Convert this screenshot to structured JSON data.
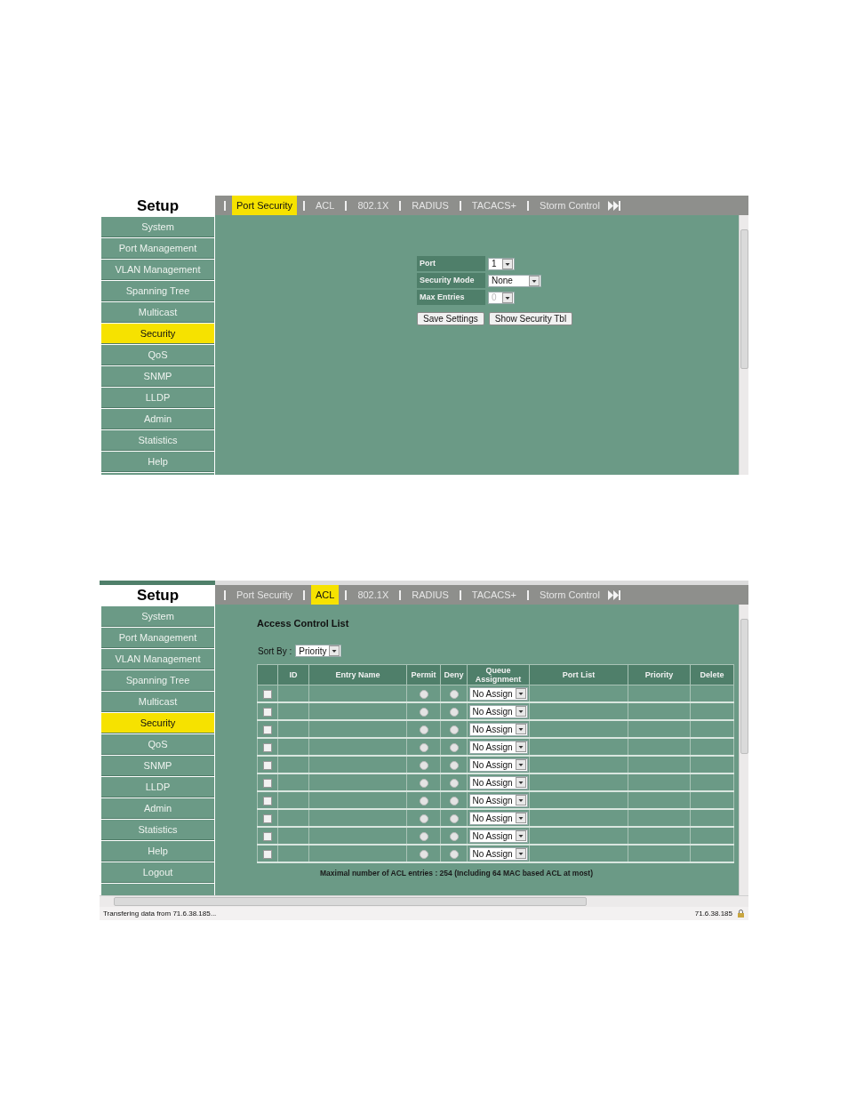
{
  "screens": [
    {
      "sidebar": {
        "title": "Setup",
        "items": [
          {
            "label": "System",
            "selected": false
          },
          {
            "label": "Port Management",
            "selected": false
          },
          {
            "label": "VLAN Management",
            "selected": false
          },
          {
            "label": "Spanning Tree",
            "selected": false
          },
          {
            "label": "Multicast",
            "selected": false
          },
          {
            "label": "Security",
            "selected": true
          },
          {
            "label": "QoS",
            "selected": false
          },
          {
            "label": "SNMP",
            "selected": false
          },
          {
            "label": "LLDP",
            "selected": false
          },
          {
            "label": "Admin",
            "selected": false
          },
          {
            "label": "Statistics",
            "selected": false
          },
          {
            "label": "Help",
            "selected": false
          }
        ]
      },
      "tabs": [
        {
          "label": "Port Security",
          "selected": true
        },
        {
          "label": "ACL",
          "selected": false
        },
        {
          "label": "802.1X",
          "selected": false
        },
        {
          "label": "RADIUS",
          "selected": false
        },
        {
          "label": "TACACS+",
          "selected": false
        },
        {
          "label": "Storm Control",
          "selected": false
        }
      ],
      "content": {
        "kind": "form",
        "fields": [
          {
            "label": "Port",
            "value": "1",
            "disabled": false
          },
          {
            "label": "Security Mode",
            "value": "None",
            "disabled": false
          },
          {
            "label": "Max Entries",
            "value": "0",
            "disabled": true
          }
        ],
        "buttons": [
          "Save Settings",
          "Show Security Tbl"
        ]
      }
    },
    {
      "sidebar": {
        "title": "Setup",
        "items": [
          {
            "label": "System",
            "selected": false
          },
          {
            "label": "Port Management",
            "selected": false
          },
          {
            "label": "VLAN Management",
            "selected": false
          },
          {
            "label": "Spanning Tree",
            "selected": false
          },
          {
            "label": "Multicast",
            "selected": false
          },
          {
            "label": "Security",
            "selected": true
          },
          {
            "label": "QoS",
            "selected": false
          },
          {
            "label": "SNMP",
            "selected": false
          },
          {
            "label": "LLDP",
            "selected": false
          },
          {
            "label": "Admin",
            "selected": false
          },
          {
            "label": "Statistics",
            "selected": false
          },
          {
            "label": "Help",
            "selected": false
          },
          {
            "label": "Logout",
            "selected": false
          }
        ]
      },
      "tabs": [
        {
          "label": "Port Security",
          "selected": false
        },
        {
          "label": "ACL",
          "selected": true
        },
        {
          "label": "802.1X",
          "selected": false
        },
        {
          "label": "RADIUS",
          "selected": false
        },
        {
          "label": "TACACS+",
          "selected": false
        },
        {
          "label": "Storm Control",
          "selected": false
        }
      ],
      "content": {
        "kind": "table",
        "title": "Access Control List",
        "sort": {
          "label": "Sort By :",
          "value": "Priority"
        },
        "table": {
          "columns": [
            "ID",
            "Entry Name",
            "Permit",
            "Deny",
            "Queue Assignment",
            "Port List",
            "Priority",
            "Delete"
          ],
          "rows": [
            {
              "checked": false,
              "permit": false,
              "deny": false,
              "queue": "No Assign"
            },
            {
              "checked": false,
              "permit": false,
              "deny": false,
              "queue": "No Assign"
            },
            {
              "checked": false,
              "permit": false,
              "deny": false,
              "queue": "No Assign"
            },
            {
              "checked": false,
              "permit": false,
              "deny": false,
              "queue": "No Assign"
            },
            {
              "checked": false,
              "permit": false,
              "deny": false,
              "queue": "No Assign"
            },
            {
              "checked": false,
              "permit": false,
              "deny": false,
              "queue": "No Assign"
            },
            {
              "checked": false,
              "permit": false,
              "deny": false,
              "queue": "No Assign"
            },
            {
              "checked": false,
              "permit": false,
              "deny": false,
              "queue": "No Assign"
            },
            {
              "checked": false,
              "permit": false,
              "deny": false,
              "queue": "No Assign"
            },
            {
              "checked": false,
              "permit": false,
              "deny": false,
              "queue": "No Assign"
            }
          ]
        },
        "note": "Maximal number of ACL entries : 254 (Including 64 MAC based ACL at most)"
      },
      "status_bar": {
        "message": "Transfering data from 71.6.38.185...",
        "address": "71.6.38.185"
      }
    }
  ]
}
